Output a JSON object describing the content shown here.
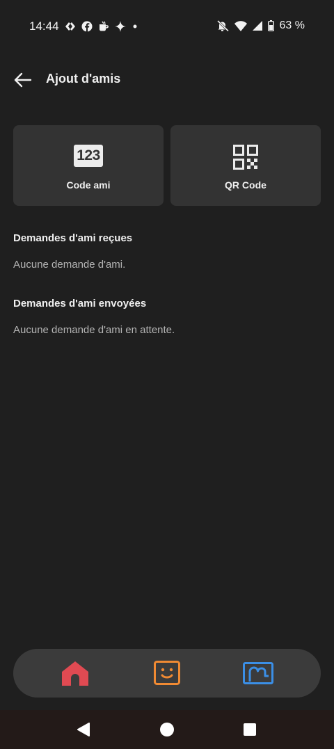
{
  "status_bar": {
    "time": "14:44",
    "battery": "63 %",
    "icons": [
      "carrefour-icon",
      "facebook-icon",
      "mug-icon",
      "sparkle-icon",
      "dot-icon",
      "mute-icon",
      "wifi-icon",
      "signal-icon",
      "battery-icon"
    ]
  },
  "header": {
    "title": "Ajout d'amis"
  },
  "options": {
    "friend_code": {
      "label": "Code ami",
      "icon_text": "123"
    },
    "qr_code": {
      "label": "QR Code"
    }
  },
  "received": {
    "title": "Demandes d'ami reçues",
    "empty": "Aucune demande d'ami."
  },
  "sent": {
    "title": "Demandes d'ami envoyées",
    "empty": "Aucune demande d'ami en attente."
  },
  "nav": {
    "colors": {
      "home": "#e04a52",
      "face": "#f08a33",
      "map": "#3b8fe6"
    }
  },
  "colors": {
    "background": "#1f1f1f",
    "card": "#333333",
    "nav_bar": "#3b3b3b"
  }
}
